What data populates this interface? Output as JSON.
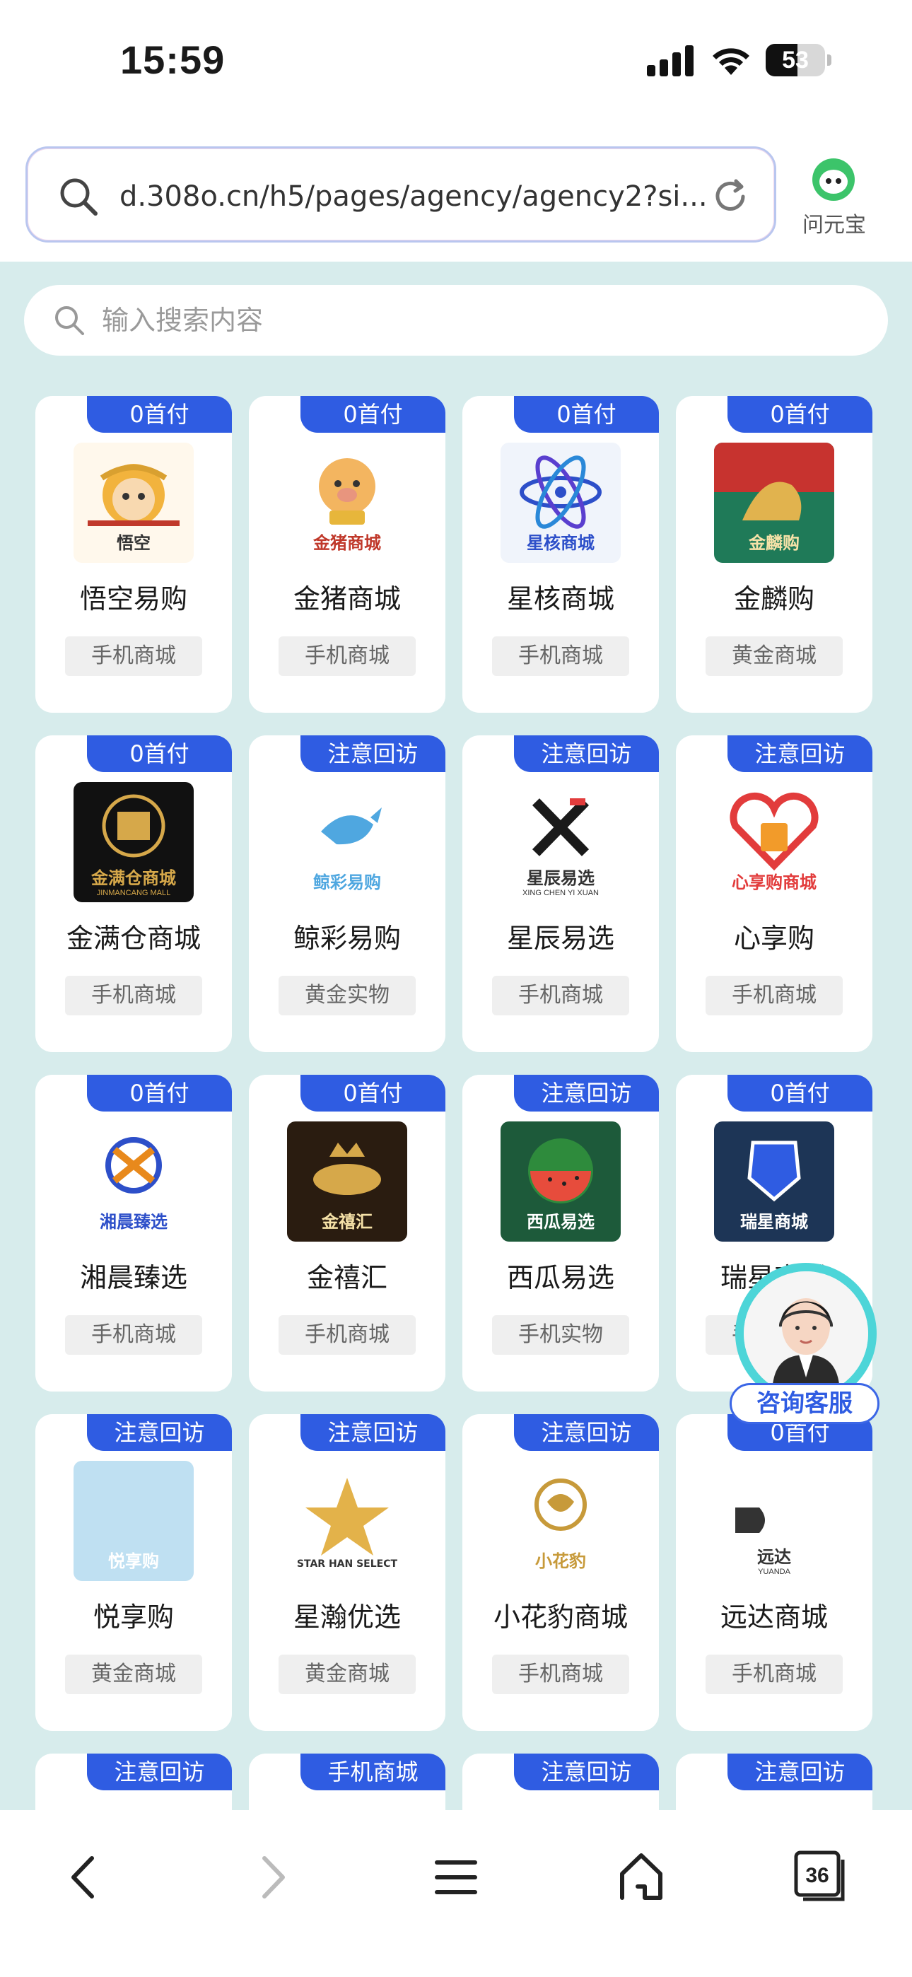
{
  "status": {
    "time": "15:59",
    "battery": "53",
    "battery_level": 0.53
  },
  "browser": {
    "url": "d.308o.cn/h5/pages/agency/agency2?si...",
    "assistant_label": "问元宝",
    "tab_count": "36"
  },
  "search": {
    "placeholder": "输入搜索内容"
  },
  "cards": [
    {
      "badge": "0首付",
      "name": "悟空易购",
      "tag": "手机商城",
      "logo_text": "悟空"
    },
    {
      "badge": "0首付",
      "name": "金猪商城",
      "tag": "手机商城",
      "logo_text": "金猪商城"
    },
    {
      "badge": "0首付",
      "name": "星核商城",
      "tag": "手机商城",
      "logo_text": "星核商城"
    },
    {
      "badge": "0首付",
      "name": "金麟购",
      "tag": "黄金商城",
      "logo_text": "金麟购"
    },
    {
      "badge": "0首付",
      "name": "金满仓商城",
      "tag": "手机商城",
      "logo_text": "金满仓商城",
      "logo_sub": "JINMANCANG MALL"
    },
    {
      "badge": "注意回访",
      "name": "鲸彩易购",
      "tag": "黄金实物",
      "logo_text": "鲸彩易购"
    },
    {
      "badge": "注意回访",
      "name": "星辰易选",
      "tag": "手机商城",
      "logo_text": "星辰易选",
      "logo_sub": "XING CHEN YI XUAN"
    },
    {
      "badge": "注意回访",
      "name": "心享购",
      "tag": "手机商城",
      "logo_text": "心享购商城"
    },
    {
      "badge": "0首付",
      "name": "湘晨臻选",
      "tag": "手机商城",
      "logo_text": "湘晨臻选"
    },
    {
      "badge": "0首付",
      "name": "金禧汇",
      "tag": "手机商城",
      "logo_text": "金禧汇"
    },
    {
      "badge": "注意回访",
      "name": "西瓜易选",
      "tag": "手机实物",
      "logo_text": "西瓜易选"
    },
    {
      "badge": "0首付",
      "name": "瑞星商城",
      "tag": "手机商城",
      "logo_text": "瑞星商城"
    },
    {
      "badge": "注意回访",
      "name": "悦享购",
      "tag": "黄金商城",
      "logo_text": "悦享购"
    },
    {
      "badge": "注意回访",
      "name": "星瀚优选",
      "tag": "黄金商城",
      "logo_text": "STAR HAN SELECT"
    },
    {
      "badge": "注意回访",
      "name": "小花豹商城",
      "tag": "手机商城",
      "logo_text": "小花豹"
    },
    {
      "badge": "0首付",
      "name": "远达商城",
      "tag": "手机商城",
      "logo_text": "远达",
      "logo_sub": "YUANDA"
    },
    {
      "badge": "注意回访",
      "name": "",
      "tag": ""
    },
    {
      "badge": "手机商城",
      "name": "",
      "tag": ""
    },
    {
      "badge": "注意回访",
      "name": "",
      "tag": ""
    },
    {
      "badge": "注意回访",
      "name": "",
      "tag": ""
    }
  ],
  "service": {
    "label": "咨询客服"
  },
  "colors": {
    "accent": "#2f5ce2",
    "background": "#d7ecec"
  }
}
